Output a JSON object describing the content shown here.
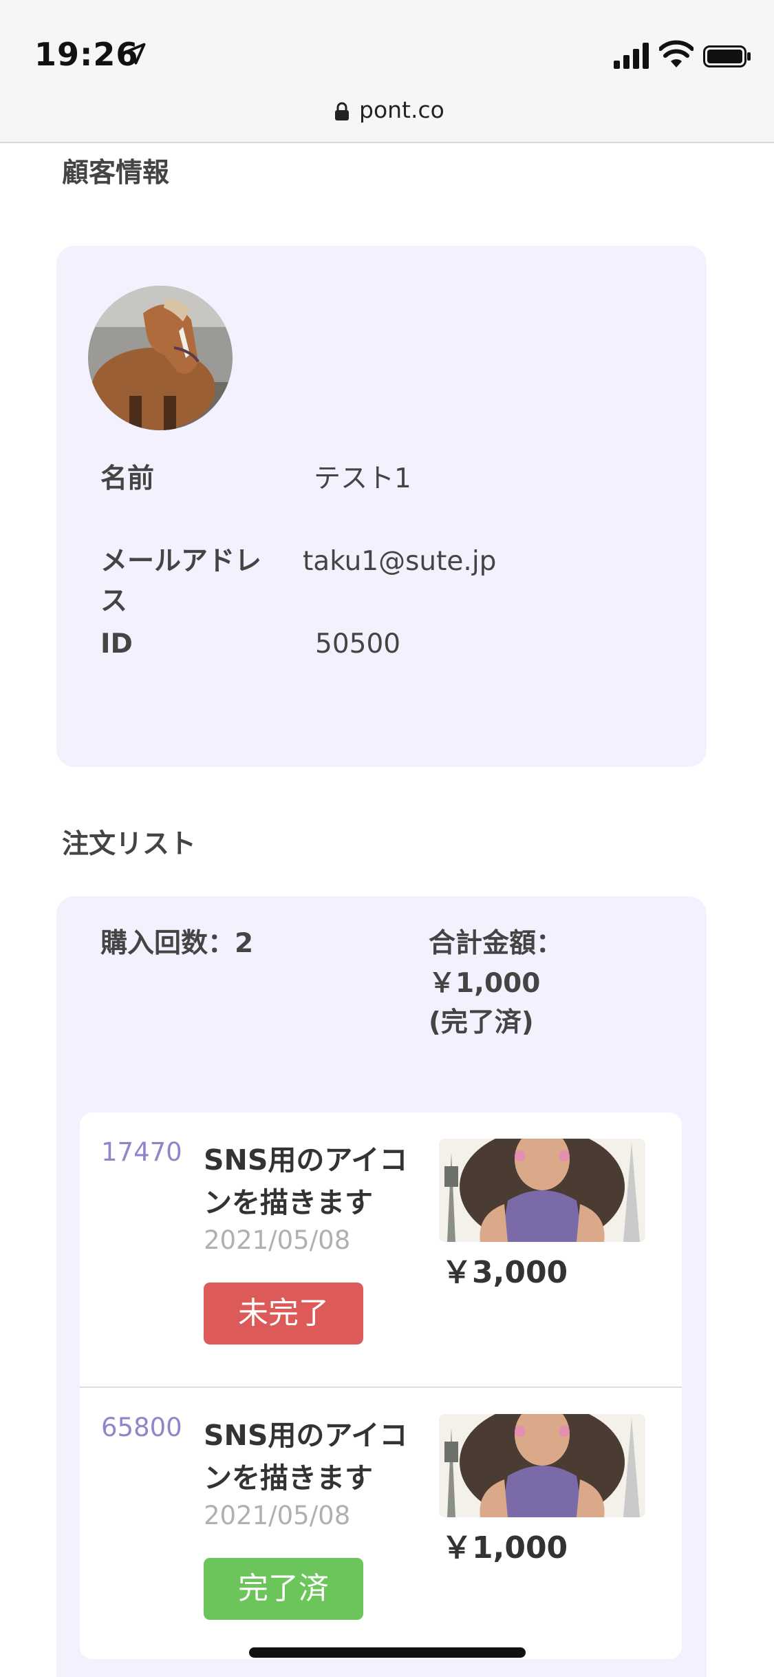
{
  "status_bar": {
    "time": "19:26"
  },
  "url_bar": {
    "url": "pont.co"
  },
  "customer": {
    "section_title": "顧客情報",
    "name_label": "名前",
    "name_value": "テスト1",
    "email_label": "メールアドレス",
    "email_value": "taku1@sute.jp",
    "id_label": "ID",
    "id_value": "50500"
  },
  "orders": {
    "section_title": "注文リスト",
    "purchase_count": "購入回数：2",
    "total_label": "合計金額：",
    "total_value": "￥1,000",
    "total_status": "(完了済)",
    "items": [
      {
        "id": "17470",
        "title": "SNS用のアイコンを描きます",
        "date": "2021/05/08",
        "status": "未完了",
        "status_color": "#dc5a57",
        "price": "￥3,000"
      },
      {
        "id": "65800",
        "title": "SNS用のアイコンを描きます",
        "date": "2021/05/08",
        "status": "完了済",
        "status_color": "#6cc55b",
        "price": "￥1,000"
      }
    ]
  }
}
